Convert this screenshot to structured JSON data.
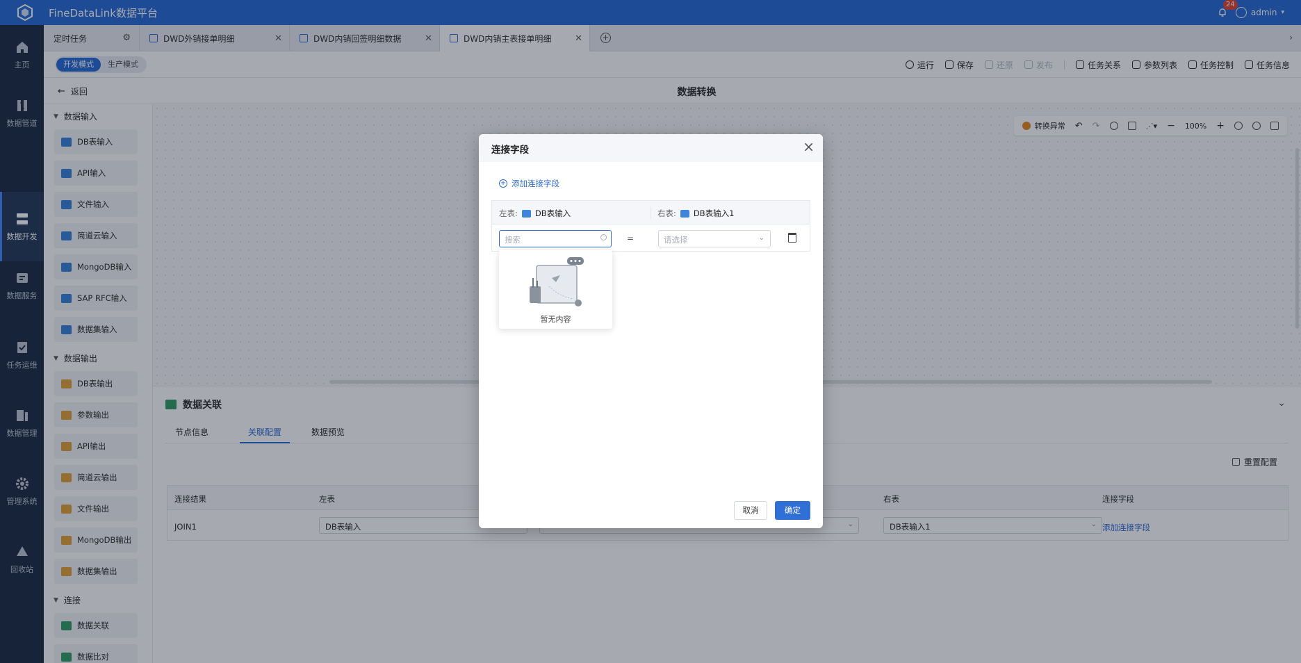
{
  "app": {
    "title": "FineDataLink数据平台",
    "notif_count": "24",
    "user": "admin",
    "accent": "#2f6fd6"
  },
  "nav": [
    {
      "label": "主页",
      "icon": "home-icon"
    },
    {
      "label": "数据管道",
      "icon": "pipeline-icon"
    },
    {
      "label": "数据开发",
      "icon": "develop-icon",
      "active": true
    },
    {
      "label": "数据服务",
      "icon": "service-icon"
    },
    {
      "label": "任务运维",
      "icon": "ops-icon"
    },
    {
      "label": "数据管理",
      "icon": "manage-icon"
    },
    {
      "label": "管理系统",
      "icon": "gear-icon"
    },
    {
      "label": "回收站",
      "icon": "recycle-icon"
    }
  ],
  "tabs": {
    "scheduled": "定时任务",
    "items": [
      "DWD外销接单明细",
      "DWD内销回签明细数据",
      "DWD内销主表接单明细"
    ]
  },
  "toolbar": {
    "modes": [
      "开发模式",
      "生产模式"
    ],
    "actions": [
      "运行",
      "保存",
      "还原",
      "发布",
      "任务关系",
      "参数列表",
      "任务控制",
      "任务信息"
    ]
  },
  "subheader": {
    "back": "返回",
    "title": "数据转换"
  },
  "panel": {
    "groups": [
      {
        "title": "数据输入",
        "items": [
          "DB表输入",
          "API输入",
          "文件输入",
          "简道云输入",
          "MongoDB输入",
          "SAP RFC输入",
          "数据集输入"
        ]
      },
      {
        "title": "数据输出",
        "items": [
          "DB表输出",
          "参数输出",
          "API输出",
          "简道云输出",
          "文件输出",
          "MongoDB输出",
          "数据集输出"
        ]
      },
      {
        "title": "连接",
        "items": [
          "数据关联",
          "数据比对"
        ]
      }
    ]
  },
  "canvas_toolbar": {
    "warning": "转换异常",
    "zoom": "100%"
  },
  "bottom": {
    "title": "数据关联",
    "tabs": [
      "节点信息",
      "关联配置",
      "数据预览"
    ],
    "reset": "重置配置",
    "table": {
      "headers": [
        "连接结果",
        "左表",
        "右表",
        "连接字段"
      ],
      "row": {
        "result": "JOIN1",
        "left": "DB表输入",
        "right": "DB表输入1",
        "field_link": "添加连接字段"
      }
    }
  },
  "modal": {
    "title": "连接字段",
    "add": "添加连接字段",
    "left_label": "左表:",
    "left_value": "DB表输入",
    "right_label": "右表:",
    "right_value": "DB表输入1",
    "search_placeholder": "搜索",
    "equals": "=",
    "select_placeholder": "请选择",
    "empty": "暂无内容",
    "cancel": "取消",
    "ok": "确定"
  }
}
